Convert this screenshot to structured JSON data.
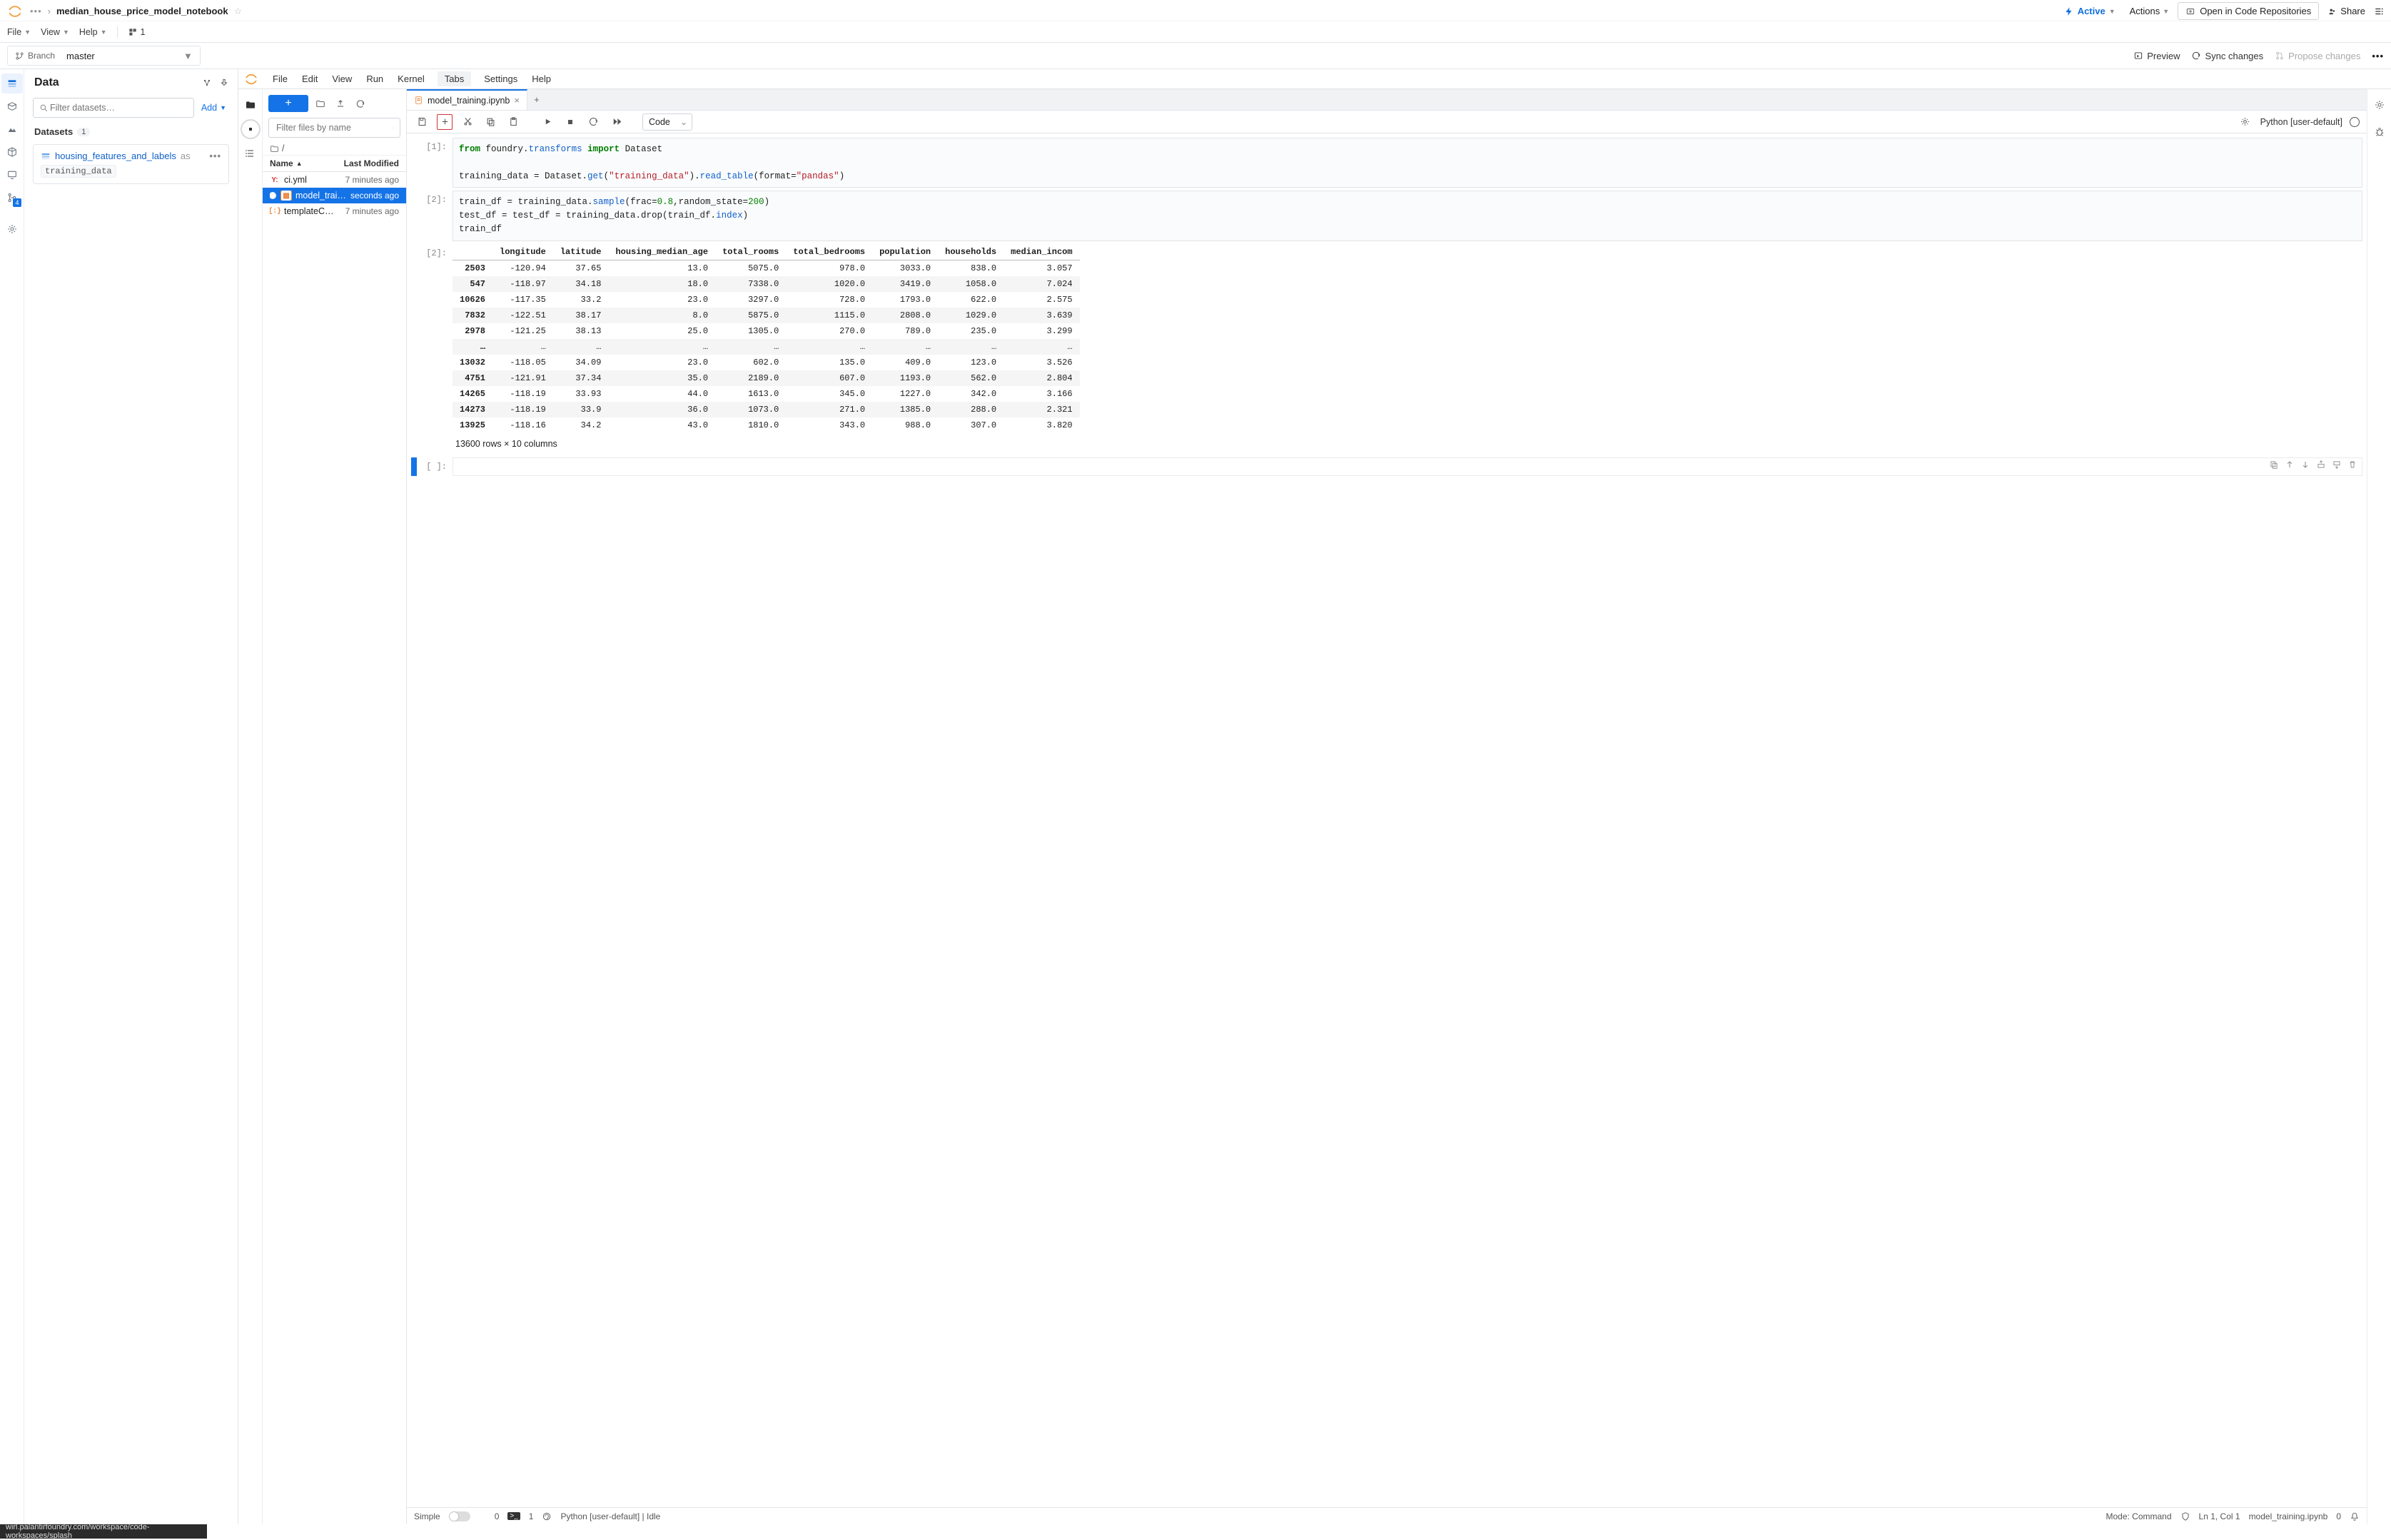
{
  "header": {
    "breadcrumb_title": "median_house_price_model_notebook",
    "menu": {
      "file": "File",
      "view": "View",
      "help": "Help",
      "diag": "1"
    },
    "active_label": "Active",
    "actions_label": "Actions",
    "open_repo_label": "Open in Code Repositories",
    "share_label": "Share",
    "branch_label": "Branch",
    "branch_value": "master",
    "preview": "Preview",
    "sync": "Sync changes",
    "propose": "Propose changes"
  },
  "data_panel": {
    "title": "Data",
    "filter_placeholder": "Filter datasets…",
    "add_label": "Add",
    "datasets_label": "Datasets",
    "datasets_count": "1",
    "dataset_name": "housing_features_and_labels",
    "as_txt": "as",
    "dataset_alias": "training_data"
  },
  "jupyter": {
    "menu": {
      "file": "File",
      "edit": "Edit",
      "view": "View",
      "run": "Run",
      "kernel": "Kernel",
      "tabs": "Tabs",
      "settings": "Settings",
      "help": "Help"
    },
    "file_panel": {
      "filter_placeholder": "Filter files by name",
      "crumb": "/",
      "col_name": "Name",
      "col_mod": "Last Modified",
      "rows": [
        {
          "icon": "yml",
          "name": "ci.yml",
          "mod": "7 minutes ago",
          "sel": false,
          "modified": false
        },
        {
          "icon": "nb",
          "name": "model_trai…",
          "mod": "seconds ago",
          "sel": true,
          "modified": true
        },
        {
          "icon": "json",
          "name": "templateC…",
          "mod": "7 minutes ago",
          "sel": false,
          "modified": false
        }
      ]
    },
    "tab_name": "model_training.ipynb",
    "cell_type_label": "Code",
    "kernel_label": "Python [user-default]",
    "cell1": {
      "prompt": "[1]:",
      "l1_a": "from",
      "l1_b": "foundry",
      "l1_c": "transforms",
      "l1_d": "import",
      "l1_e": "Dataset",
      "l2_a": "training_data = Dataset",
      "l2_b": "get",
      "l2_c": "\"training_data\"",
      "l2_d": "read_table",
      "l2_e": "format=",
      "l2_f": "\"pandas\""
    },
    "cell2": {
      "prompt": "[2]:",
      "l1_a": "train_df = training_data",
      "l1_b": "sample",
      "l1_c": "frac=",
      "l1_d": "0.8",
      "l1_e": ",random_state=",
      "l1_f": "200",
      "l2": "test_df = test_df = training_data.drop(train_df.",
      "l2_b": "index",
      "l2_c": ")",
      "l3": "train_df"
    },
    "out_prompt": "[2]:",
    "table": {
      "columns": [
        "",
        "longitude",
        "latitude",
        "housing_median_age",
        "total_rooms",
        "total_bedrooms",
        "population",
        "households",
        "median_incom"
      ],
      "rows": [
        [
          "2503",
          "-120.94",
          "37.65",
          "13.0",
          "5075.0",
          "978.0",
          "3033.0",
          "838.0",
          "3.057"
        ],
        [
          "547",
          "-118.97",
          "34.18",
          "18.0",
          "7338.0",
          "1020.0",
          "3419.0",
          "1058.0",
          "7.024"
        ],
        [
          "10626",
          "-117.35",
          "33.2",
          "23.0",
          "3297.0",
          "728.0",
          "1793.0",
          "622.0",
          "2.575"
        ],
        [
          "7832",
          "-122.51",
          "38.17",
          "8.0",
          "5875.0",
          "1115.0",
          "2808.0",
          "1029.0",
          "3.639"
        ],
        [
          "2978",
          "-121.25",
          "38.13",
          "25.0",
          "1305.0",
          "270.0",
          "789.0",
          "235.0",
          "3.299"
        ],
        [
          "…",
          "…",
          "…",
          "…",
          "…",
          "…",
          "…",
          "…",
          "…"
        ],
        [
          "13032",
          "-118.05",
          "34.09",
          "23.0",
          "602.0",
          "135.0",
          "409.0",
          "123.0",
          "3.526"
        ],
        [
          "4751",
          "-121.91",
          "37.34",
          "35.0",
          "2189.0",
          "607.0",
          "1193.0",
          "562.0",
          "2.804"
        ],
        [
          "14265",
          "-118.19",
          "33.93",
          "44.0",
          "1613.0",
          "345.0",
          "1227.0",
          "342.0",
          "3.166"
        ],
        [
          "14273",
          "-118.19",
          "33.9",
          "36.0",
          "1073.0",
          "271.0",
          "1385.0",
          "288.0",
          "2.321"
        ],
        [
          "13925",
          "-118.16",
          "34.2",
          "43.0",
          "1810.0",
          "343.0",
          "988.0",
          "307.0",
          "3.820"
        ]
      ],
      "caption": "13600 rows × 10 columns"
    },
    "empty_prompt": "[ ]:"
  },
  "status": {
    "simple": "Simple",
    "count0": "0",
    "count1": "1",
    "kernel": "Python [user-default] | Idle",
    "mode": "Mode: Command",
    "pos": "Ln 1, Col 1",
    "file": "model_training.ipynb",
    "zero": "0"
  },
  "rail_badge": "4",
  "url": "wirl.palantirfoundry.com/workspace/code-workspaces/splash"
}
